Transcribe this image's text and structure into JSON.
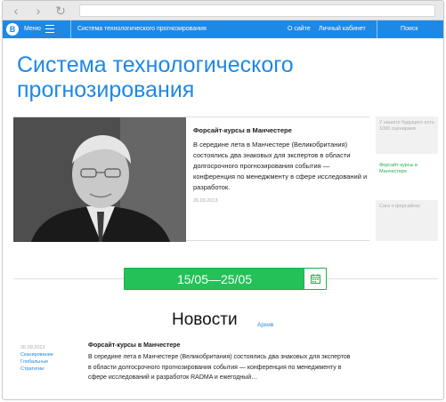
{
  "nav": {
    "logo_letter": "B",
    "menu_label": "Меню",
    "section_title": "Система технологического прогнозирования",
    "about": "О сайте",
    "cabinet": "Личный кабинет",
    "search": "Поиск"
  },
  "page": {
    "title": "Система технологического прогнозирования"
  },
  "hero": {
    "title": "Форсайт-курсы в Манчестере",
    "body": "В середине лета в Манчестере (Великобритания) состоялись два знаковых для экспертов в области долгосрочного прогнозирования события — конференция по менеджменту в сфере исследований и разработок.",
    "date": "26.09.2013"
  },
  "sidebar": {
    "top_text": "У нашего будущего есть 1000 сценариев",
    "link": "Форсайт-курсы в Манчестере",
    "bottom_text": "Сага о форсайтах"
  },
  "date_strip": {
    "range": "15/05—25/05"
  },
  "news": {
    "heading": "Новости",
    "archive": "Архив",
    "item": {
      "date": "26.09.2013",
      "tags": [
        "Сканирование",
        "Глобальные",
        "Стратегии"
      ],
      "title": "Форсайт-курсы в Манчестере",
      "body": "В середине лета в Манчестере (Великобритания) состоялись два знаковых для экспертов в области долгосрочного прогнозирования события — конференция по менеджменту в сфере исследований и разработок RADMA и ежегодный…"
    }
  },
  "icons": [
    "back-arrow-icon",
    "forward-arrow-icon",
    "reload-icon",
    "hamburger-icon",
    "calendar-icon"
  ],
  "colors": {
    "brand_blue": "#1e88e5",
    "accent_green": "#23c158"
  }
}
